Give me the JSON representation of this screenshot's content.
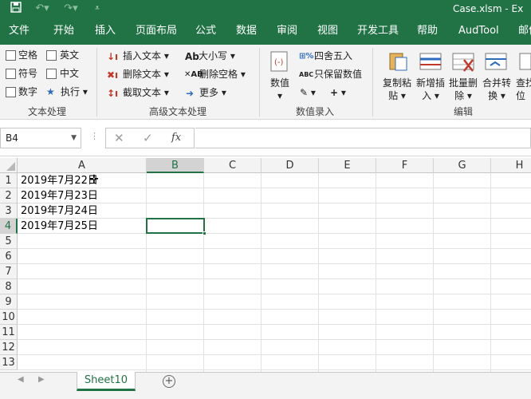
{
  "window": {
    "title": "Case.xlsm  -  Ex"
  },
  "quick_access": {
    "icons": [
      "save-icon",
      "undo-icon",
      "redo-icon",
      "customize-icon"
    ]
  },
  "ribbon_tabs": [
    "文件",
    "开始",
    "插入",
    "页面布局",
    "公式",
    "数据",
    "审阅",
    "视图",
    "开发工具",
    "帮助",
    "AudTool",
    "邮件"
  ],
  "groups": {
    "text_processing": {
      "label": "文本处理",
      "checkboxes": [
        "空格",
        "英文",
        "符号",
        "中文",
        "数字"
      ],
      "execute": "执行"
    },
    "advanced_text": {
      "label": "高级文本处理",
      "buttons": [
        "插入文本",
        "删除文本",
        "截取文本",
        "大小写",
        "删除空格",
        "更多"
      ]
    },
    "numeric_entry": {
      "label": "数值录入",
      "value_button": "数值",
      "round": "四舍五入",
      "keep_values": "只保留数值"
    },
    "edit": {
      "label": "编辑",
      "buttons": [
        {
          "line1": "复制粘",
          "line2": "贴"
        },
        {
          "line1": "新增插",
          "line2": "入"
        },
        {
          "line1": "批量删",
          "line2": "除"
        },
        {
          "line1": "合并转",
          "line2": "换"
        },
        {
          "line1": "查找",
          "line2": "位"
        }
      ]
    }
  },
  "formula_bar": {
    "name_box": "B4",
    "formula": ""
  },
  "columns": [
    "A",
    "B",
    "C",
    "D",
    "E",
    "F",
    "G",
    "H"
  ],
  "rows": [
    "1",
    "2",
    "3",
    "4",
    "5",
    "6",
    "7",
    "8",
    "9",
    "10",
    "11",
    "12",
    "13"
  ],
  "cells": [
    "2019年7月22日",
    "2019年7月23日",
    "2019年7月24日",
    "2019年7月25日"
  ],
  "selected_cell": "B4",
  "sheet": {
    "active_tab": "Sheet10"
  },
  "colors": {
    "accent": "#217346"
  }
}
